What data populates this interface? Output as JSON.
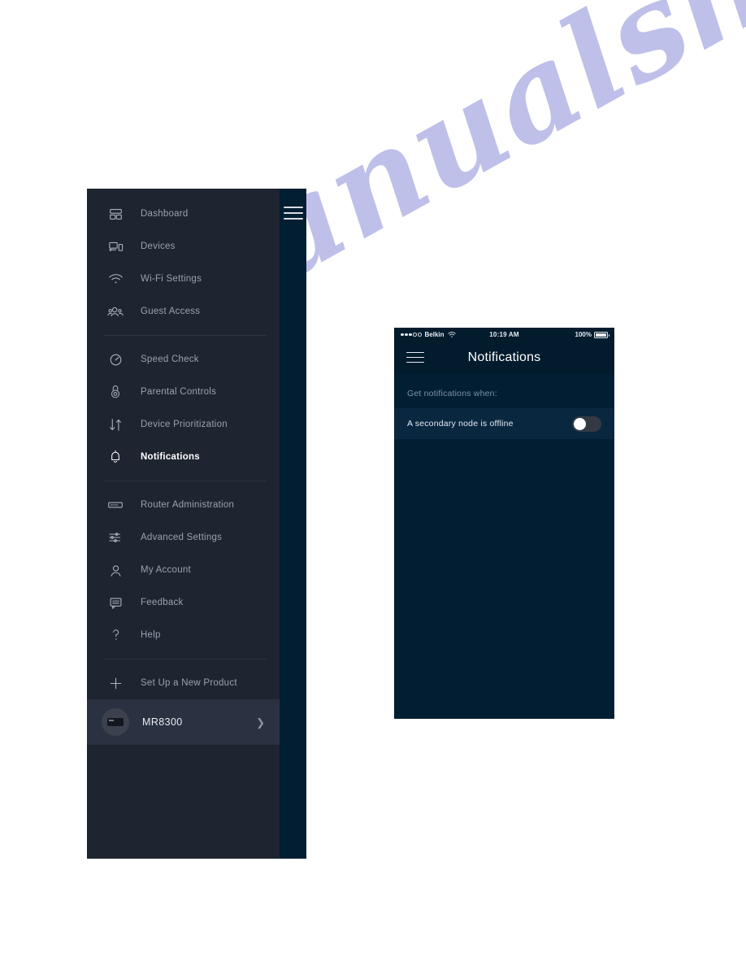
{
  "watermark": {
    "text": "manualshive.com"
  },
  "menu_panel": {
    "hamburger_icon": "hamburger-menu-icon",
    "groups": [
      {
        "items": [
          {
            "label": "Dashboard",
            "icon": "dashboard-icon",
            "active": false
          },
          {
            "label": "Devices",
            "icon": "devices-icon",
            "active": false
          },
          {
            "label": "Wi-Fi Settings",
            "icon": "wifi-icon",
            "active": false
          },
          {
            "label": "Guest Access",
            "icon": "guest-access-icon",
            "active": false
          }
        ]
      },
      {
        "items": [
          {
            "label": "Speed Check",
            "icon": "speedometer-icon",
            "active": false
          },
          {
            "label": "Parental Controls",
            "icon": "lock-icon",
            "active": false
          },
          {
            "label": "Device Prioritization",
            "icon": "updown-arrows-icon",
            "active": false
          },
          {
            "label": "Notifications",
            "icon": "bell-icon",
            "active": true
          }
        ]
      },
      {
        "items": [
          {
            "label": "Router Administration",
            "icon": "router-icon",
            "active": false
          },
          {
            "label": "Advanced Settings",
            "icon": "sliders-icon",
            "active": false
          },
          {
            "label": "My Account",
            "icon": "person-icon",
            "active": false
          },
          {
            "label": "Feedback",
            "icon": "speech-bubble-icon",
            "active": false
          },
          {
            "label": "Help",
            "icon": "question-mark-icon",
            "active": false
          }
        ]
      },
      {
        "items": [
          {
            "label": "Set Up a New Product",
            "icon": "plus-icon",
            "active": false
          }
        ]
      }
    ],
    "device": {
      "name": "MR8300",
      "avatar_icon": "router-thumbnail-icon",
      "chevron_icon": "chevron-right-icon"
    }
  },
  "phone": {
    "status_bar": {
      "signal_filled": 3,
      "signal_empty": 2,
      "carrier": "Belkin",
      "wifi_icon": "wifi-icon",
      "time": "10:19 AM",
      "battery_percent": "100%",
      "battery_icon": "battery-full-icon"
    },
    "header": {
      "menu_icon": "hamburger-menu-icon",
      "title": "Notifications"
    },
    "caption": "Get notifications when:",
    "settings": [
      {
        "label": "A secondary node is offline",
        "toggle_state": "off"
      }
    ]
  },
  "colors": {
    "menu_bg": "#1e2430",
    "menu_rail": "#021e33",
    "phone_bg": "#011e33",
    "row_bg": "#0a2740",
    "active_text": "#ffffff",
    "muted_text": "#9aa3b0",
    "watermark": "#2b33b8"
  }
}
